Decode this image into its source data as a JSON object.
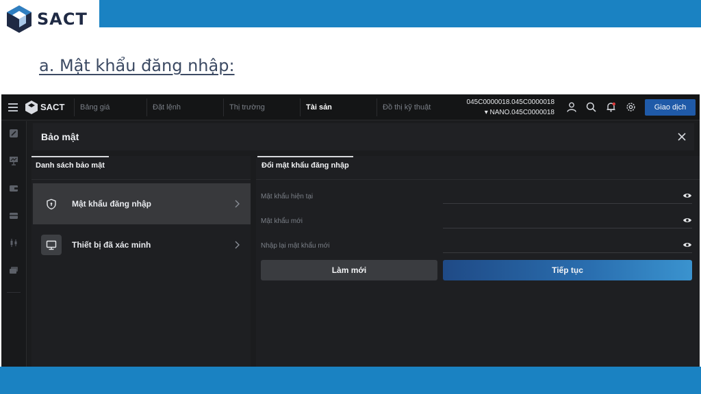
{
  "slide": {
    "brand": "SACT",
    "heading": "a. Mật khẩu đăng nhập:",
    "colors": {
      "band": "#1a82c2",
      "heading": "#3c4a63"
    }
  },
  "app": {
    "brand": "SACT",
    "nav_tabs": [
      {
        "label": "Bảng giá",
        "active": false
      },
      {
        "label": "Đặt lệnh",
        "active": false
      },
      {
        "label": "Thị trường",
        "active": false
      },
      {
        "label": "Tài sản",
        "active": true
      },
      {
        "label": "Đồ thị kỹ thuật",
        "active": false
      }
    ],
    "account": {
      "line1": "045C0000018.045C0000018",
      "line2": "▾ NANO.045C0000018"
    },
    "header_icons": [
      "user-icon",
      "search-icon",
      "bell-icon",
      "gear-icon"
    ],
    "trade_button": "Giao dịch",
    "rail_icons": [
      "pencil-icon",
      "chart-board-icon",
      "wallet-icon",
      "card-icon",
      "candlestick-icon",
      "layers-icon"
    ],
    "colors": {
      "accent": "#1f5aa8",
      "background": "#1b1c1e",
      "notification_dot": "#e23b3b"
    }
  },
  "panel": {
    "title": "Bảo mật",
    "close_icon": "close-icon"
  },
  "security_list": {
    "header": "Danh sách bảo mật",
    "items": [
      {
        "label": "Mật khẩu đăng nhập",
        "icon": "shield-icon",
        "active": true
      },
      {
        "label": "Thiết bị đã xác minh",
        "icon": "monitor-icon",
        "active": false
      }
    ]
  },
  "change_password": {
    "header": "Đổi mật khẩu đăng nhập",
    "fields": [
      {
        "label": "Mật khẩu hiện tại",
        "value": ""
      },
      {
        "label": "Mật khẩu mới",
        "value": ""
      },
      {
        "label": "Nhập lại mật khẩu mới",
        "value": ""
      }
    ],
    "reset_button": "Làm mới",
    "continue_button": "Tiếp tục"
  }
}
